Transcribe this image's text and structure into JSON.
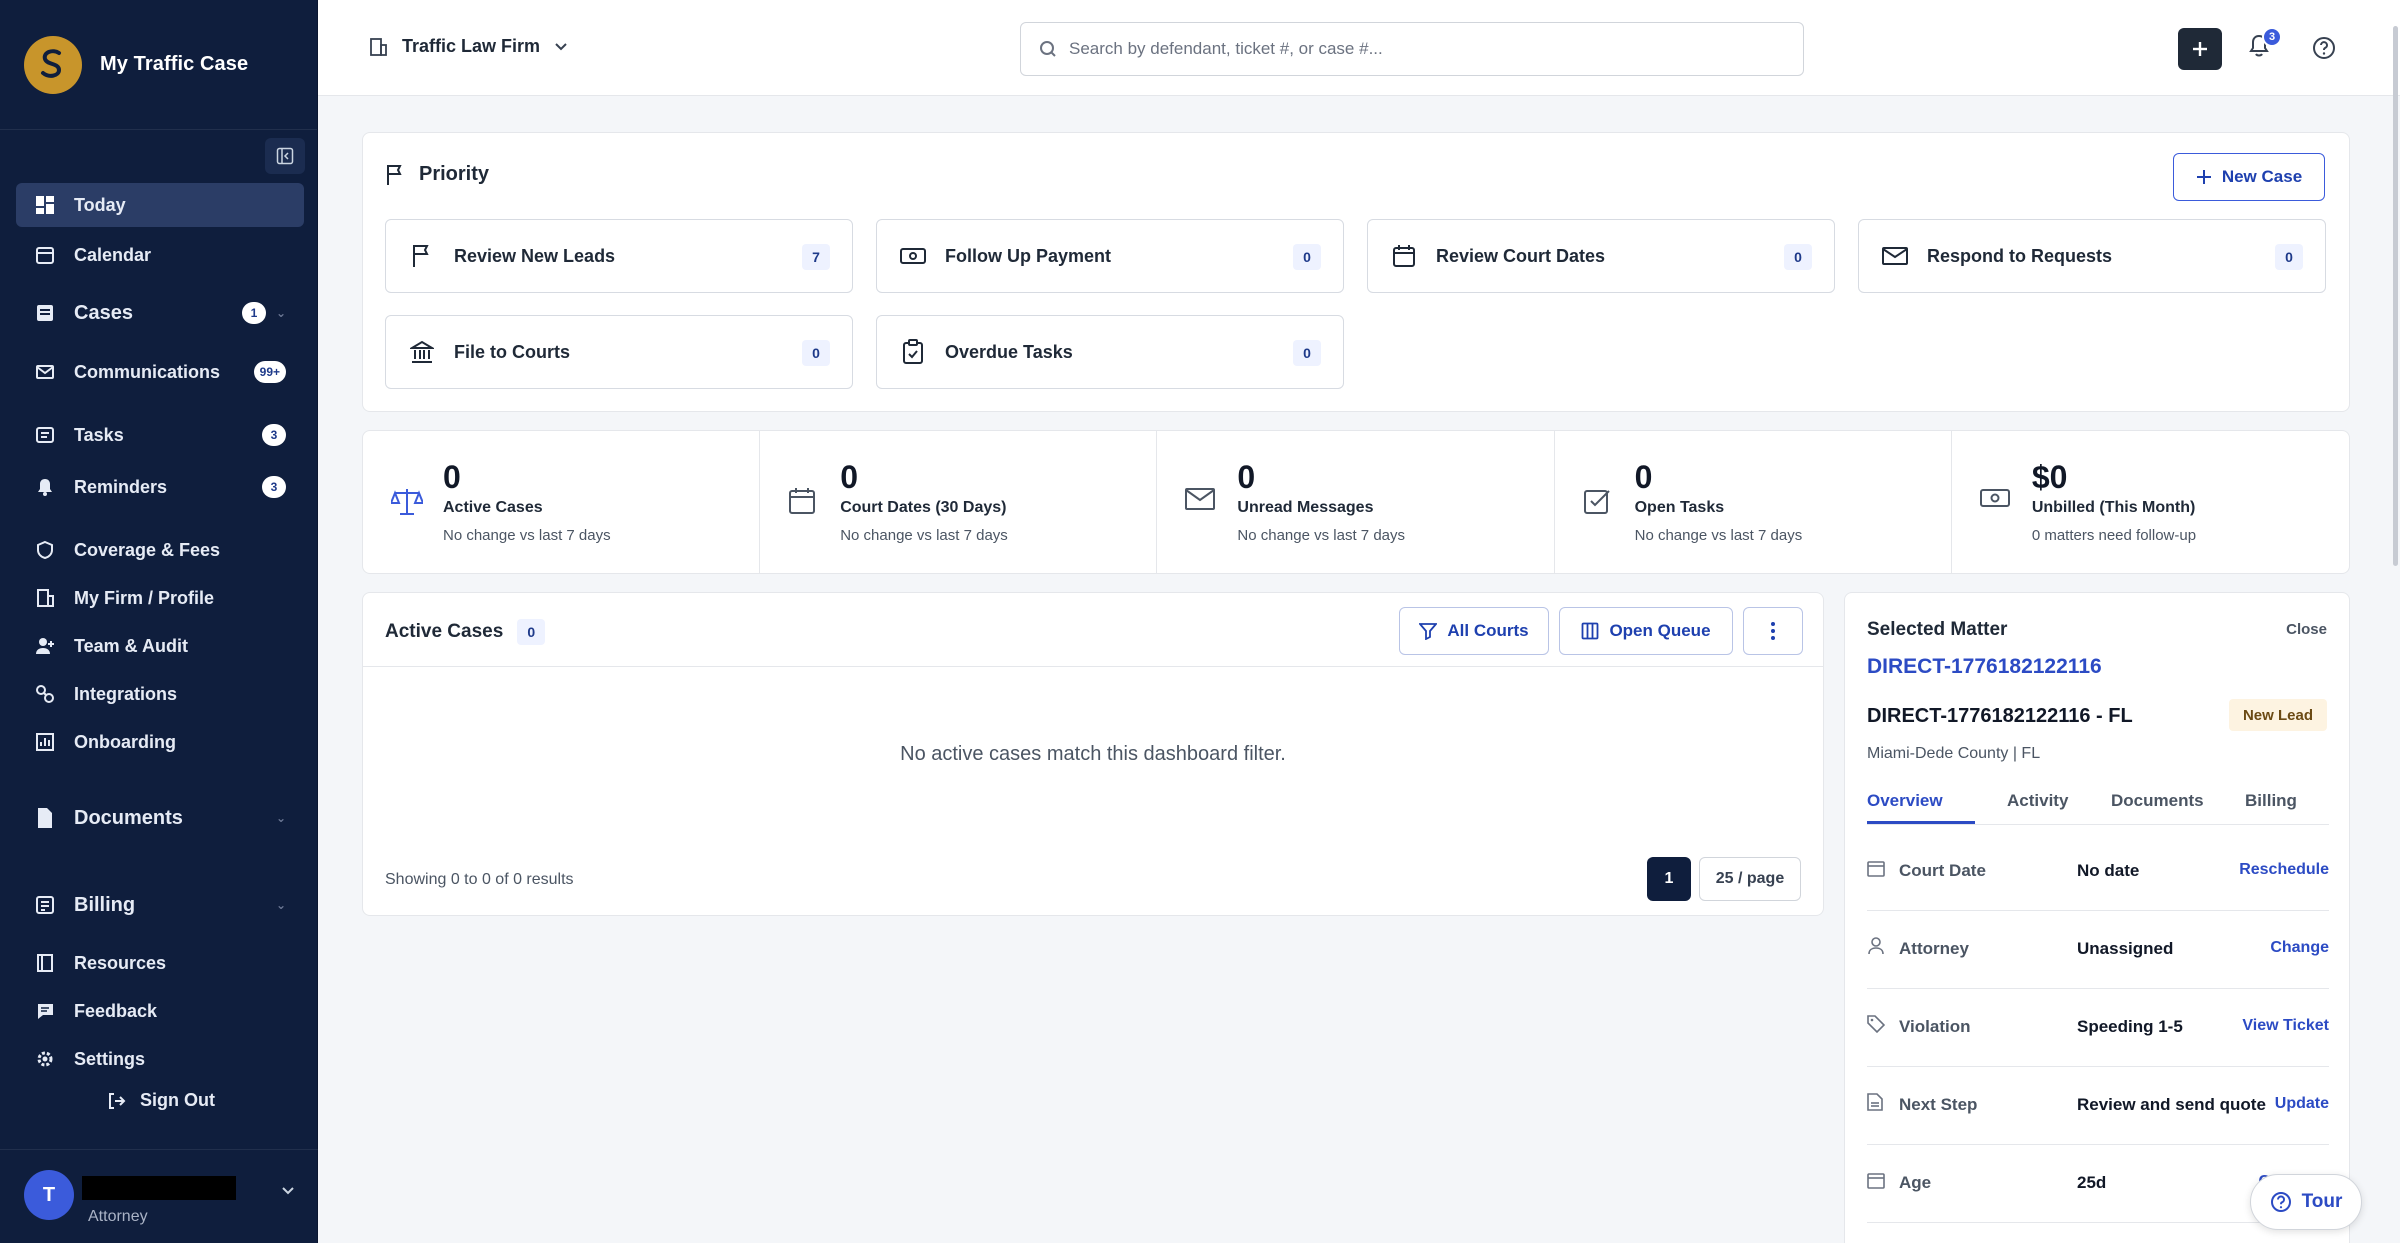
{
  "app": {
    "title": "My Traffic Case"
  },
  "sidebar": {
    "items": [
      {
        "label": "Today",
        "icon": "dashboard-icon"
      },
      {
        "label": "Calendar",
        "icon": "calendar-icon"
      },
      {
        "label": "Cases",
        "icon": "cases-icon",
        "badge": "1"
      },
      {
        "label": "Communications",
        "icon": "mail-icon",
        "badge": "99+"
      },
      {
        "label": "Tasks",
        "icon": "tasks-icon",
        "badge": "3"
      },
      {
        "label": "Reminders",
        "icon": "bell-icon",
        "badge": "3"
      },
      {
        "label": "Coverage & Fees",
        "icon": "shield-icon"
      },
      {
        "label": "My Firm / Profile",
        "icon": "building-icon"
      },
      {
        "label": "Team & Audit",
        "icon": "user-add-icon"
      },
      {
        "label": "Integrations",
        "icon": "link-icon"
      },
      {
        "label": "Onboarding",
        "icon": "chart-icon"
      },
      {
        "label": "Documents",
        "icon": "document-icon"
      },
      {
        "label": "Billing",
        "icon": "billing-icon"
      },
      {
        "label": "Resources",
        "icon": "resources-icon"
      },
      {
        "label": "Feedback",
        "icon": "feedback-icon"
      },
      {
        "label": "Settings",
        "icon": "gear-icon"
      }
    ],
    "signout": "Sign Out",
    "user": {
      "initial": "T",
      "role": "Attorney"
    }
  },
  "topbar": {
    "firm": "Traffic Law Firm",
    "search_placeholder": "Search by defendant, ticket #, or case #...",
    "notifications": "3"
  },
  "priority": {
    "title": "Priority",
    "new_case": "New Case",
    "tiles": [
      {
        "label": "Review New Leads",
        "count": "7",
        "icon": "flag-icon"
      },
      {
        "label": "Follow Up Payment",
        "count": "0",
        "icon": "cash-icon"
      },
      {
        "label": "Review Court Dates",
        "count": "0",
        "icon": "calendar-icon"
      },
      {
        "label": "Respond to Requests",
        "count": "0",
        "icon": "mail-icon"
      },
      {
        "label": "File to Courts",
        "count": "0",
        "icon": "courthouse-icon"
      },
      {
        "label": "Overdue Tasks",
        "count": "0",
        "icon": "clipboard-icon"
      }
    ]
  },
  "stats": [
    {
      "value": "0",
      "label": "Active Cases",
      "sub": "No change vs last 7 days",
      "icon": "scales-icon"
    },
    {
      "value": "0",
      "label": "Court Dates (30 Days)",
      "sub": "No change vs last 7 days",
      "icon": "calendar-icon"
    },
    {
      "value": "0",
      "label": "Unread Messages",
      "sub": "No change vs last 7 days",
      "icon": "mail-icon"
    },
    {
      "value": "0",
      "label": "Open Tasks",
      "sub": "No change vs last 7 days",
      "icon": "checkbox-icon"
    },
    {
      "value": "$0",
      "label": "Unbilled (This Month)",
      "sub": "0 matters need follow-up",
      "icon": "cash-icon"
    }
  ],
  "active_cases": {
    "title": "Active Cases",
    "count": "0",
    "all_courts": "All Courts",
    "open_queue": "Open Queue",
    "empty": "No active cases match this dashboard filter.",
    "footer": "Showing 0 to 0 of 0 results",
    "page": "1",
    "per_page": "25 / page"
  },
  "matter": {
    "title": "Selected Matter",
    "close": "Close",
    "link": "DIRECT-1776182122116",
    "name": "DIRECT-1776182122116 - FL",
    "tag": "New Lead",
    "location": "Miami-Dede County | FL",
    "tabs": [
      "Overview",
      "Activity",
      "Documents",
      "Billing"
    ],
    "rows": [
      {
        "key": "Court Date",
        "value": "No date",
        "action": "Reschedule",
        "icon": "calendar-icon"
      },
      {
        "key": "Attorney",
        "value": "Unassigned",
        "action": "Change",
        "icon": "user-icon"
      },
      {
        "key": "Violation",
        "value": "Speeding 1-5",
        "action": "View Ticket",
        "icon": "tag-icon"
      },
      {
        "key": "Next Step",
        "value": "Review and send quote",
        "action": "Update",
        "icon": "document-icon"
      },
      {
        "key": "Age",
        "value": "25d",
        "action": "Ca",
        "icon": "calendar-icon"
      }
    ]
  },
  "tour": "Tour",
  "colors": {
    "sidebar": "#0f1e3d",
    "accent": "#2c4bc4",
    "brand": "#c8952b"
  }
}
